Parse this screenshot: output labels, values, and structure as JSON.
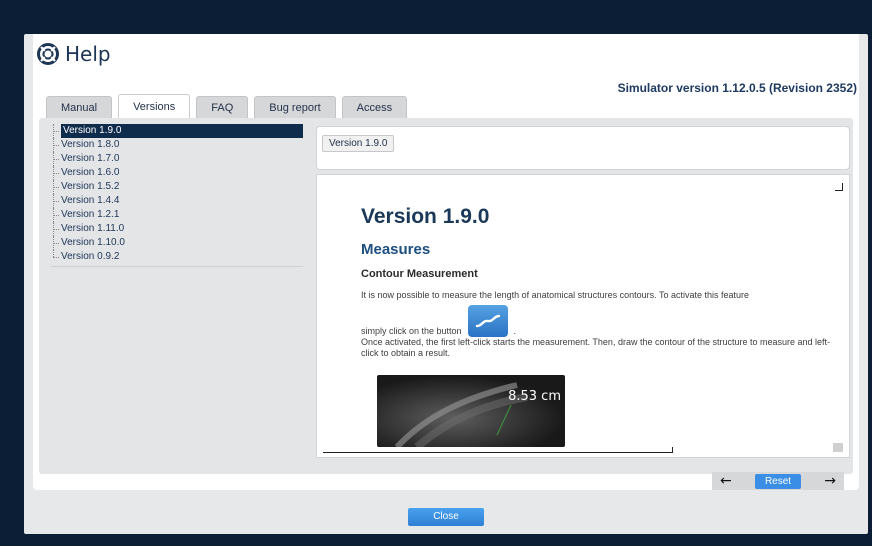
{
  "dialog": {
    "title": "Help",
    "title_icon": "lifebuoy-icon",
    "simulator_version": "Simulator version 1.12.0.5 (Revision 2352)",
    "close_label": "Close"
  },
  "tabs": [
    {
      "label": "Manual"
    },
    {
      "label": "Versions",
      "active": true
    },
    {
      "label": "FAQ"
    },
    {
      "label": "Bug report"
    },
    {
      "label": "Access"
    }
  ],
  "versions_tree": [
    {
      "label": "Version 1.9.0",
      "selected": true
    },
    {
      "label": "Version 1.8.0"
    },
    {
      "label": "Version 1.7.0"
    },
    {
      "label": "Version 1.6.0"
    },
    {
      "label": "Version 1.5.2"
    },
    {
      "label": "Version 1.4.4"
    },
    {
      "label": "Version 1.2.1"
    },
    {
      "label": "Version 1.11.0"
    },
    {
      "label": "Version 1.10.0"
    },
    {
      "label": "Version 0.9.2"
    }
  ],
  "viewer": {
    "breadcrumb_button": "Version 1.9.0",
    "heading": "Version 1.9.0",
    "section": "Measures",
    "subsection": "Contour Measurement",
    "paragraph1": "It is now possible to measure the length of anatomical structures contours. To activate this feature",
    "paragraph2_prefix": "simply click on the button",
    "paragraph2_suffix": ".",
    "paragraph3": "Once activated, the first left-click starts the measurement. Then, draw the contour of the structure to measure and left-click to obtain a result.",
    "measurement_value": "8.53 cm"
  },
  "nav": {
    "prev_icon": "arrow-left-icon",
    "reset_label": "Reset",
    "next_icon": "arrow-right-icon"
  },
  "colors": {
    "background": "#0b1e36",
    "accent": "#3a8ee6",
    "selected_row": "#0f2c4c",
    "heading": "#1a3858"
  }
}
